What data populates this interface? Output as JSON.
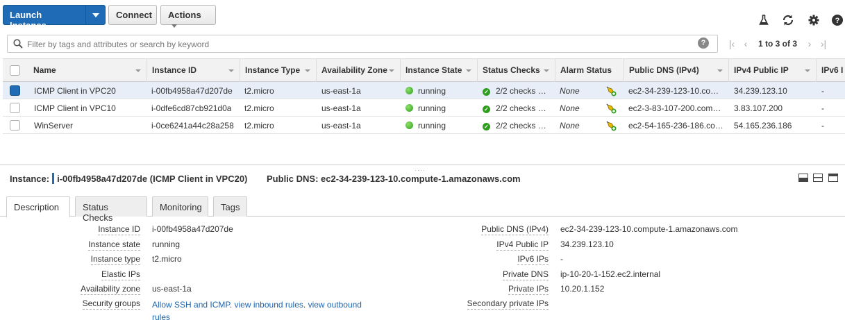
{
  "toolbar": {
    "launch_label": "Launch Instance",
    "connect_label": "Connect",
    "actions_label": "Actions"
  },
  "filter": {
    "placeholder": "Filter by tags and attributes or search by keyword",
    "pagination": "1 to 3 of 3"
  },
  "table": {
    "columns": [
      "Name",
      "Instance ID",
      "Instance Type",
      "Availability Zone",
      "Instance State",
      "Status Checks",
      "Alarm Status",
      "Public DNS (IPv4)",
      "IPv4 Public IP",
      "IPv6 I"
    ],
    "rows": [
      {
        "name": "ICMP Client in VPC20",
        "id": "i-00fb4958a47d207de",
        "type": "t2.micro",
        "az": "us-east-1a",
        "state": "running",
        "checks": "2/2 checks …",
        "alarm": "None",
        "dns": "ec2-34-239-123-10.co…",
        "ip": "34.239.123.10",
        "ipv6": "-",
        "selected": true
      },
      {
        "name": "ICMP Client in VPC10",
        "id": "i-0dfe6cd87cb921d0a",
        "type": "t2.micro",
        "az": "us-east-1a",
        "state": "running",
        "checks": "2/2 checks …",
        "alarm": "None",
        "dns": "ec2-3-83-107-200.com…",
        "ip": "3.83.107.200",
        "ipv6": "-",
        "selected": false
      },
      {
        "name": "WinServer",
        "id": "i-0ce6241a44c28a258",
        "type": "t2.micro",
        "az": "us-east-1a",
        "state": "running",
        "checks": "2/2 checks …",
        "alarm": "None",
        "dns": "ec2-54-165-236-186.co…",
        "ip": "54.165.236.186",
        "ipv6": "-",
        "selected": false
      }
    ]
  },
  "detail": {
    "instance_label": "Instance:",
    "instance_value": "i-00fb4958a47d207de (ICMP Client in VPC20)",
    "dns_header": "Public DNS: ec2-34-239-123-10.compute-1.amazonaws.com",
    "tabs": [
      "Description",
      "Status Checks",
      "Monitoring",
      "Tags"
    ],
    "left": [
      {
        "label": "Instance ID",
        "value": "i-00fb4958a47d207de"
      },
      {
        "label": "Instance state",
        "value": "running"
      },
      {
        "label": "Instance type",
        "value": "t2.micro"
      },
      {
        "label": "Elastic IPs",
        "value": ""
      },
      {
        "label": "Availability zone",
        "value": "us-east-1a"
      },
      {
        "label": "Security groups",
        "value": ""
      }
    ],
    "security_links": [
      "Allow SSH and ICMP",
      "view inbound rules",
      "view outbound",
      "rules"
    ],
    "right": [
      {
        "label": "Public DNS (IPv4)",
        "value": "ec2-34-239-123-10.compute-1.amazonaws.com"
      },
      {
        "label": "IPv4 Public IP",
        "value": "34.239.123.10"
      },
      {
        "label": "IPv6 IPs",
        "value": "-"
      },
      {
        "label": "Private DNS",
        "value": "ip-10-20-1-152.ec2.internal"
      },
      {
        "label": "Private IPs",
        "value": "10.20.1.152"
      },
      {
        "label": "Secondary private IPs",
        "value": ""
      }
    ]
  },
  "colors": {
    "accent": "#1f6bb5",
    "link": "#1e64ad",
    "selected_row": "#e7eef8",
    "running": "#2f9e1f"
  }
}
